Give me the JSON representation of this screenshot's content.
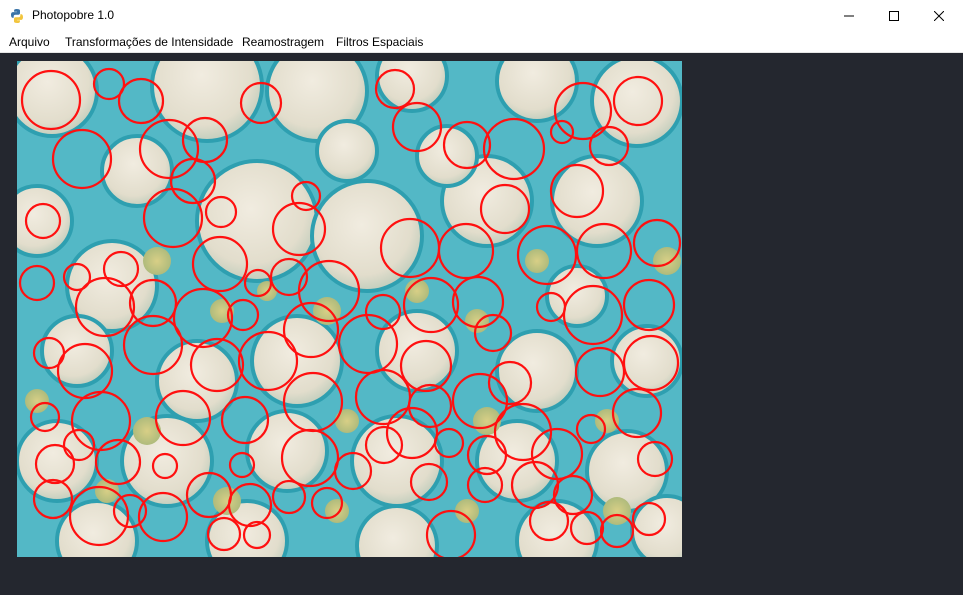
{
  "window": {
    "title": "Photopobre 1.0",
    "app_icon": "python-icon"
  },
  "menu": {
    "items": [
      "Arquivo",
      "Transformações de Intensidade",
      "Reamostragem",
      "Filtros Espaciais"
    ]
  },
  "image": {
    "description_icon": "microscope-cells-image",
    "overlay_color": "#ff0000",
    "background_color": "#4fb6c4"
  },
  "colors": {
    "workspace": "#24272f",
    "titlebar": "#ffffff"
  }
}
